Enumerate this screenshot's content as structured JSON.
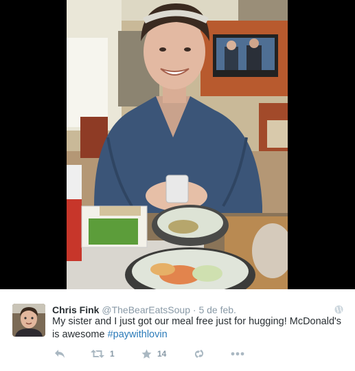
{
  "tweet": {
    "fullname": "Chris Fink",
    "username": "@TheBearEatsSoup",
    "separator": "·",
    "timestamp": "5 de feb.",
    "text_before_hashtag": "My sister and I just got our meal free just for hugging! McDonald's is awesome ",
    "hashtag": "#paywithlovin",
    "retweet_count": "1",
    "favorite_count": "14"
  },
  "icons": {
    "globe": "globe-icon",
    "reply": "reply-icon",
    "retweet": "retweet-icon",
    "favorite": "star-icon",
    "vine": "vine-icon",
    "more": "more-icon"
  },
  "colors": {
    "name": "#292f33",
    "muted": "#8899a6",
    "hashtag": "#2b7bb9",
    "action_icon": "#aab8c2"
  }
}
